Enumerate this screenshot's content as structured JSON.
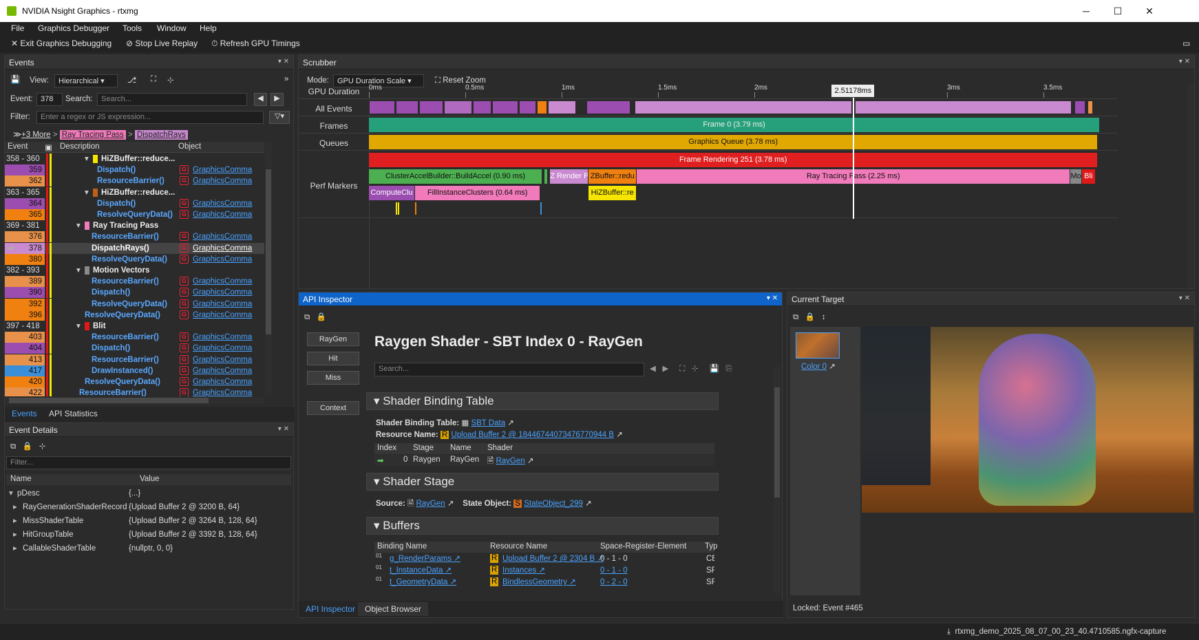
{
  "window": {
    "title": "NVIDIA Nsight Graphics - rtxmg",
    "min": "─",
    "max": "☐",
    "close": "✕"
  },
  "menu": [
    "File",
    "Graphics Debugger",
    "Tools",
    "Window",
    "Help"
  ],
  "toolbar": {
    "exit": "Exit Graphics Debugging",
    "stop": "Stop Live Replay",
    "refresh": "Refresh GPU Timings"
  },
  "events": {
    "title": "Events",
    "view_label": "View:",
    "view_value": "Hierarchical",
    "event_label": "Event:",
    "event_value": "378",
    "search_label": "Search:",
    "search_placeholder": "Search...",
    "filter_label": "Filter:",
    "filter_placeholder": "Enter a regex or JS expression...",
    "breadcrumb": {
      "more": "+3 More",
      "pass": "Ray Tracing Pass",
      "call": "DispatchRays"
    },
    "columns": {
      "event": "Event",
      "description": "Description",
      "object": "Object"
    },
    "rows": [
      {
        "ev": "358 - 360",
        "desc": "HiZBuffer::reduce...",
        "obj": "",
        "group": true,
        "evcolor": "",
        "marker": "#f5e500"
      },
      {
        "ev": "359",
        "desc": "Dispatch()",
        "obj": "GraphicsComma",
        "evcolor": "#9b4db0"
      },
      {
        "ev": "362",
        "desc": "ResourceBarrier()",
        "obj": "GraphicsComma",
        "evcolor": "#e8914a"
      },
      {
        "ev": "363 - 365",
        "desc": "HiZBuffer::reduce...",
        "obj": "",
        "group": true,
        "evcolor": "",
        "marker": "#c06018"
      },
      {
        "ev": "364",
        "desc": "Dispatch()",
        "obj": "GraphicsComma",
        "evcolor": "#9b4db0"
      },
      {
        "ev": "365",
        "desc": "ResolveQueryData()",
        "obj": "GraphicsComma",
        "evcolor": "#f08010"
      },
      {
        "ev": "369 - 381",
        "desc": "Ray Tracing Pass",
        "obj": "",
        "group": true,
        "evcolor": "",
        "marker": "#f07aba"
      },
      {
        "ev": "376",
        "desc": "ResourceBarrier()",
        "obj": "GraphicsComma",
        "evcolor": "#e8914a"
      },
      {
        "ev": "378",
        "desc": "DispatchRays()",
        "obj": "GraphicsComma",
        "evcolor": "#c98ad0",
        "selected": true
      },
      {
        "ev": "380",
        "desc": "ResolveQueryData()",
        "obj": "GraphicsComma",
        "evcolor": "#f08010"
      },
      {
        "ev": "382 - 393",
        "desc": "Motion Vectors",
        "obj": "",
        "group": true,
        "evcolor": "",
        "marker": "#8a8a8a"
      },
      {
        "ev": "389",
        "desc": "ResourceBarrier()",
        "obj": "GraphicsComma",
        "evcolor": "#e8914a"
      },
      {
        "ev": "390",
        "desc": "Dispatch()",
        "obj": "GraphicsComma",
        "evcolor": "#9b4db0"
      },
      {
        "ev": "392",
        "desc": "ResolveQueryData()",
        "obj": "GraphicsComma",
        "evcolor": "#f08010"
      },
      {
        "ev": "396",
        "desc": "ResolveQueryData()",
        "obj": "GraphicsComma",
        "evcolor": "#f08010"
      },
      {
        "ev": "397 - 418",
        "desc": "Blit",
        "obj": "",
        "group": true,
        "evcolor": "",
        "marker": "#e01818"
      },
      {
        "ev": "403",
        "desc": "ResourceBarrier()",
        "obj": "GraphicsComma",
        "evcolor": "#e8914a"
      },
      {
        "ev": "404",
        "desc": "Dispatch()",
        "obj": "GraphicsComma",
        "evcolor": "#9b4db0"
      },
      {
        "ev": "413",
        "desc": "ResourceBarrier()",
        "obj": "GraphicsComma",
        "evcolor": "#e8914a"
      },
      {
        "ev": "417",
        "desc": "DrawInstanced()",
        "obj": "GraphicsComma",
        "evcolor": "#3b8fd8"
      },
      {
        "ev": "420",
        "desc": "ResolveQueryData()",
        "obj": "GraphicsComma",
        "evcolor": "#f08010"
      },
      {
        "ev": "422",
        "desc": "ResourceBarrier()",
        "obj": "GraphicsComma",
        "evcolor": "#e8914a"
      }
    ],
    "tabs": [
      "Events",
      "API Statistics"
    ]
  },
  "details": {
    "title": "Event Details",
    "filter_placeholder": "Filter...",
    "columns": {
      "name": "Name",
      "value": "Value"
    },
    "rows": [
      {
        "name": "pDesc",
        "value": "{...}"
      },
      {
        "name": "RayGenerationShaderRecord",
        "value": "{Upload Buffer 2 @ 3200 B, 64}"
      },
      {
        "name": "MissShaderTable",
        "value": "{Upload Buffer 2 @ 3264 B, 128, 64}"
      },
      {
        "name": "HitGroupTable",
        "value": "{Upload Buffer 2 @ 3392 B, 128, 64}"
      },
      {
        "name": "CallableShaderTable",
        "value": "{nullptr, 0, 0}"
      }
    ]
  },
  "scrubber": {
    "title": "Scrubber",
    "mode_label": "Mode:",
    "mode_value": "GPU Duration Scale",
    "reset": "Reset Zoom",
    "rows": [
      "GPU Duration",
      "All Events",
      "Frames",
      "Queues",
      "Perf Markers"
    ],
    "ticks": [
      "0ms",
      "0.5ms",
      "1ms",
      "1.5ms",
      "2ms",
      "2.5ms",
      "3ms",
      "3.5ms"
    ],
    "cursor": "2.51178ms",
    "frame": "Frame 0 (3.79 ms)",
    "queue": "Graphics Queue (3.78 ms)",
    "rendering": "Frame Rendering 251 (3.78 ms)",
    "markers": [
      "ClusterAccelBuilder::BuildAccel (0.90 ms)",
      "Z Render P",
      "ZBuffer::redu",
      "Ray Tracing Pass (2.25 ms)",
      "Mo",
      "Bli"
    ],
    "markers2": [
      "ComputeClu",
      "FillInstanceClusters (0.64 ms)",
      "HiZBuffer::re"
    ],
    "colors": {
      "frames": "#26a07a",
      "queue": "#e0a800",
      "render": "#e02020",
      "events": "#9b4db0"
    }
  },
  "api": {
    "title": "API Inspector",
    "heading": "Raygen Shader - SBT Index 0 - RayGen",
    "search_placeholder": "Search...",
    "nav": [
      "RayGen",
      "Hit",
      "Miss",
      "Context"
    ],
    "sbt": {
      "title": "Shader Binding Table",
      "sbt_label": "Shader Binding Table:",
      "sbt_value": "SBT Data",
      "res_label": "Resource Name:",
      "res_value": "Upload Buffer 2 @ 18446744073476770944 B",
      "cols": [
        "Index",
        "Stage",
        "Name",
        "Shader"
      ],
      "row": {
        "index": "0",
        "stage": "Raygen",
        "name": "RayGen",
        "shader": "RayGen"
      }
    },
    "stage": {
      "title": "Shader Stage",
      "source_label": "Source:",
      "source_value": "RayGen",
      "state_label": "State Object:",
      "state_value": "StateObject_299"
    },
    "buffers": {
      "title": "Buffers",
      "cols": [
        "Binding Name",
        "Resource Name",
        "Space-Register-Element",
        "Typ"
      ],
      "rows": [
        {
          "b": "g_RenderParams",
          "r": "Upload Buffer 2 @ 2304 B",
          "s": "0 - 1 - 0",
          "t": "CB"
        },
        {
          "b": "t_InstanceData",
          "r": "Instances",
          "s": "0 - 1 - 0",
          "t": "SR"
        },
        {
          "b": "t_GeometryData",
          "r": "BindlessGeometry",
          "s": "0 - 2 - 0",
          "t": "SR"
        }
      ]
    },
    "tabs": [
      "API Inspector",
      "Object Browser"
    ]
  },
  "target": {
    "title": "Current Target",
    "thumb_label": "Color 0",
    "status": "Locked: Event #465"
  },
  "status": {
    "file": "rtxmg_demo_2025_08_07_00_23_40.4710585.ngfx-capture"
  }
}
